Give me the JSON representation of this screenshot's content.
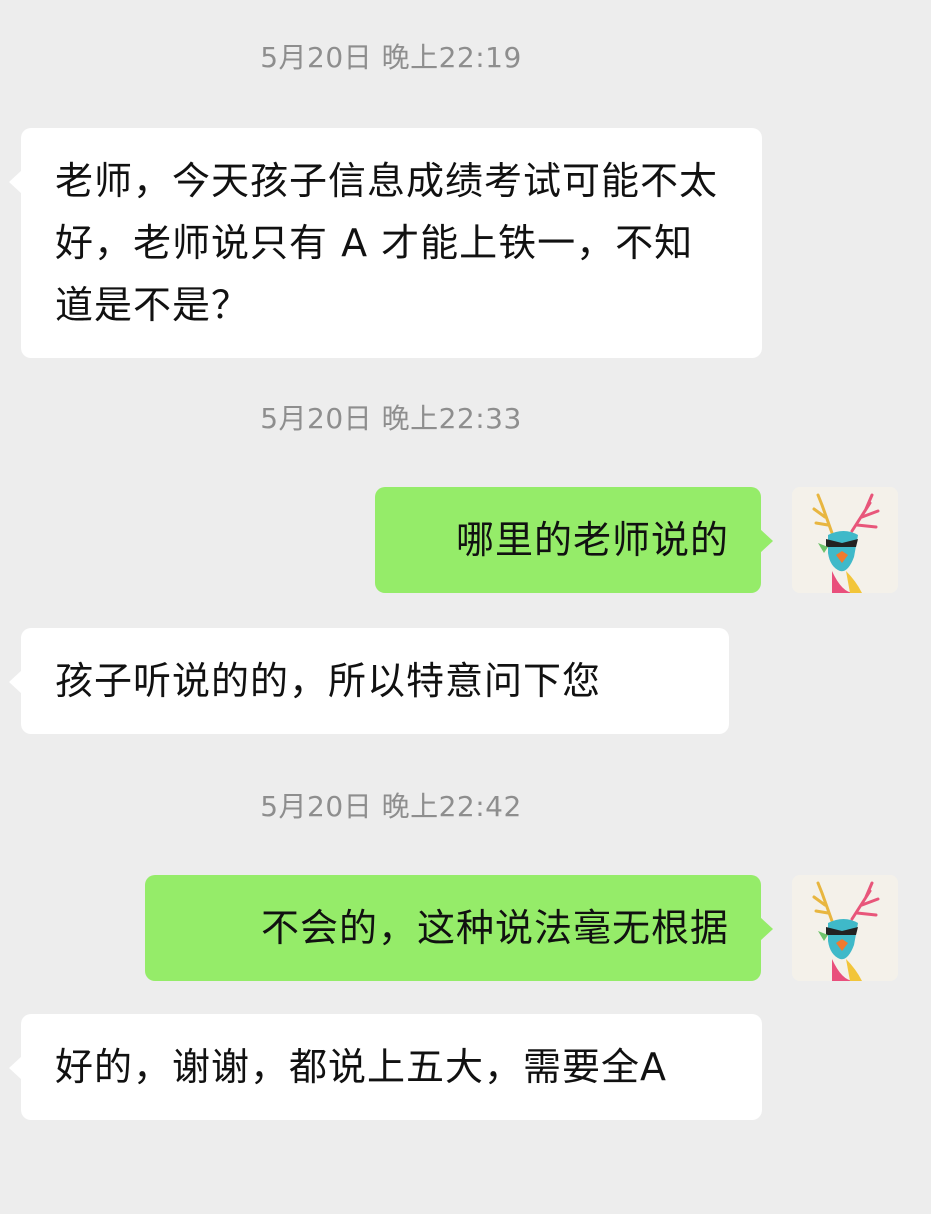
{
  "chat": {
    "timestamps": [
      "5月20日 晚上22:19",
      "5月20日 晚上22:33",
      "5月20日 晚上22:42"
    ],
    "messages": [
      {
        "side": "incoming",
        "text": "老师，今天孩子信息成绩考试可能不太好，老师说只有 A 才能上铁一，不知道是不是？"
      },
      {
        "side": "outgoing",
        "text": "哪里的老师说的"
      },
      {
        "side": "incoming",
        "text": "孩子听说的的，所以特意问下您"
      },
      {
        "side": "outgoing",
        "text": "不会的，这种说法毫无根据"
      },
      {
        "side": "incoming",
        "text": "好的，谢谢，都说上五大，需要全A"
      }
    ],
    "self_avatar": {
      "icon": "deer-avatar-icon"
    }
  },
  "colors": {
    "background": "#ededed",
    "incoming_bubble": "#ffffff",
    "outgoing_bubble": "#95ec69",
    "timestamp_text": "#8e8e8e",
    "message_text": "#111111"
  }
}
